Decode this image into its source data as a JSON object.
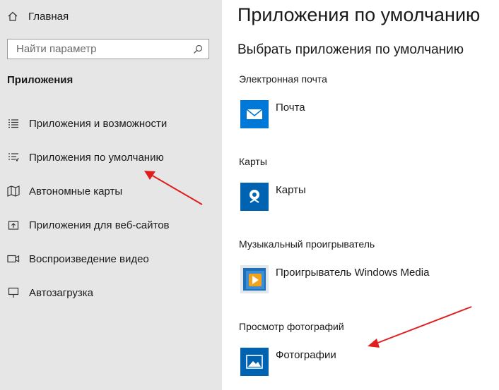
{
  "sidebar": {
    "home_label": "Главная",
    "search_placeholder": "Найти параметр",
    "section_title": "Приложения",
    "items": [
      {
        "label": "Приложения и возможности"
      },
      {
        "label": "Приложения по умолчанию"
      },
      {
        "label": "Автономные карты"
      },
      {
        "label": "Приложения для веб-сайтов"
      },
      {
        "label": "Воспроизведение видео"
      },
      {
        "label": "Автозагрузка"
      }
    ]
  },
  "main": {
    "title": "Приложения по умолчанию",
    "subtitle": "Выбрать приложения по умолчанию",
    "categories": [
      {
        "label": "Электронная почта",
        "app": "Почта",
        "icon": "mail-icon"
      },
      {
        "label": "Карты",
        "app": "Карты",
        "icon": "maps-icon"
      },
      {
        "label": "Музыкальный проигрыватель",
        "app": "Проигрыватель Windows Media",
        "icon": "media-player-icon"
      },
      {
        "label": "Просмотр фотографий",
        "app": "Фотографии",
        "icon": "photos-icon"
      }
    ]
  },
  "colors": {
    "sidebar_bg": "#e6e6e6",
    "tile_blue": "#0063b1",
    "arrow_red": "#e01e1e"
  }
}
